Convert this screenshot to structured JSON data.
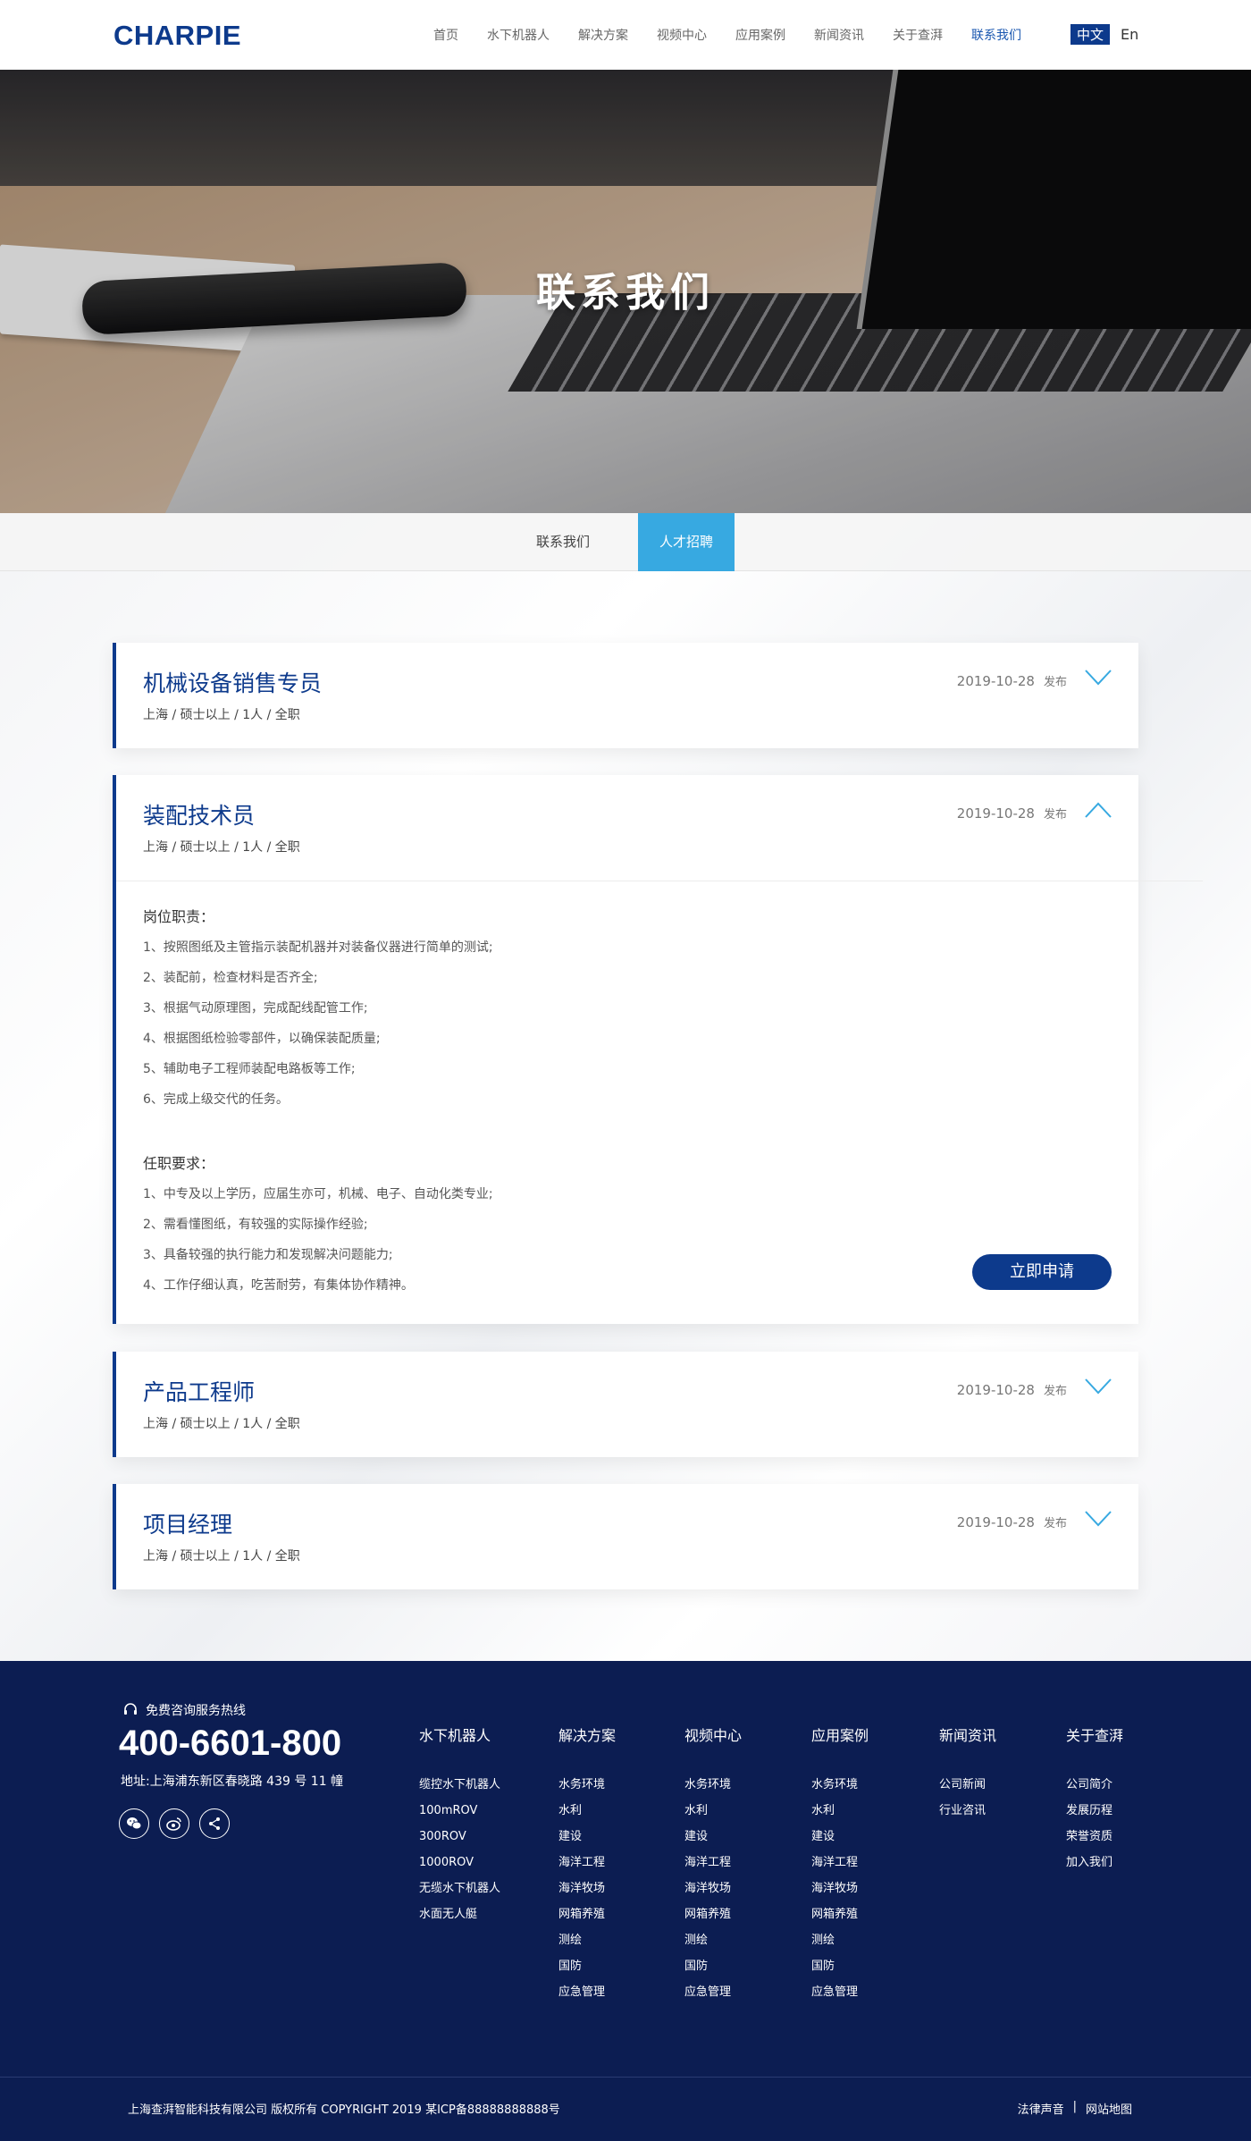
{
  "header": {
    "logo": "CHARPIE",
    "nav": [
      "首页",
      "水下机器人",
      "解决方案",
      "视频中心",
      "应用案例",
      "新闻资讯",
      "关于查湃",
      "联系我们"
    ],
    "active_nav": "联系我们",
    "lang_cn": "中文",
    "lang_en": "En"
  },
  "banner": {
    "title": "联系我们"
  },
  "tabs": {
    "contact": "联系我们",
    "recruit": "人才招聘",
    "active": "人才招聘"
  },
  "jobs": [
    {
      "title": "机械设备销售专员",
      "meta": "上海 / 硕士以上 / 1人 / 全职",
      "date": "2019-10-28",
      "date_suffix": "发布",
      "expanded": false
    },
    {
      "title": "装配技术员",
      "meta": "上海 / 硕士以上 / 1人 / 全职",
      "date": "2019-10-28",
      "date_suffix": "发布",
      "expanded": true,
      "duties_title": "岗位职责：",
      "duties": [
        "1、按照图纸及主管指示装配机器并对装备仪器进行简单的测试;",
        "2、装配前，检查材料是否齐全;",
        "3、根据气动原理图，完成配线配管工作;",
        "4、根据图纸检验零部件，以确保装配质量;",
        "5、辅助电子工程师装配电路板等工作;",
        "6、完成上级交代的任务。"
      ],
      "req_title": "任职要求：",
      "requirements": [
        "1、中专及以上学历，应届生亦可，机械、电子、自动化类专业;",
        "2、需看懂图纸，有较强的实际操作经验;",
        "3、具备较强的执行能力和发现解决问题能力;",
        "4、工作仔细认真，吃苦耐劳，有集体协作精神。"
      ],
      "apply_label": "立即申请"
    },
    {
      "title": "产品工程师",
      "meta": "上海 / 硕士以上 / 1人 / 全职",
      "date": "2019-10-28",
      "date_suffix": "发布",
      "expanded": false
    },
    {
      "title": "项目经理",
      "meta": "上海 / 硕士以上 / 1人 / 全职",
      "date": "2019-10-28",
      "date_suffix": "发布",
      "expanded": false
    }
  ],
  "footer": {
    "hotline_label": "免费咨询服务热线",
    "phone": "400-6601-800",
    "address": "地址:上海浦东新区春晓路 439 号 11 幢",
    "social_icons": [
      "wechat-icon",
      "weibo-icon",
      "share-icon"
    ],
    "columns": [
      {
        "title": "水下机器人",
        "items": [
          "缆控水下机器人",
          "100mROV",
          "300ROV",
          "1000ROV",
          "无缆水下机器人",
          "水面无人艇"
        ]
      },
      {
        "title": "解决方案",
        "items": [
          "水务环境",
          "水利",
          "建设",
          "海洋工程",
          "海洋牧场",
          "网箱养殖",
          "测绘",
          "国防",
          "应急管理"
        ]
      },
      {
        "title": "视频中心",
        "items": [
          "水务环境",
          "水利",
          "建设",
          "海洋工程",
          "海洋牧场",
          "网箱养殖",
          "测绘",
          "国防",
          "应急管理"
        ]
      },
      {
        "title": "应用案例",
        "items": [
          "水务环境",
          "水利",
          "建设",
          "海洋工程",
          "海洋牧场",
          "网箱养殖",
          "测绘",
          "国防",
          "应急管理"
        ]
      },
      {
        "title": "新闻资讯",
        "items": [
          "公司新闻",
          "行业咨讯"
        ]
      },
      {
        "title": "关于查湃",
        "items": [
          "公司简介",
          "发展历程",
          "荣誉资质",
          "加入我们"
        ]
      }
    ],
    "copyright": "上海查湃智能科技有限公司   版权所有  COPYRIGHT 2019   某ICP备88888888888号",
    "legal": "法律声音",
    "sitemap": "网站地图",
    "legal_sep": "|"
  },
  "colors": {
    "brand": "#0d3a8c",
    "accent": "#37a9e1",
    "footer_bg": "#0c1d52"
  }
}
